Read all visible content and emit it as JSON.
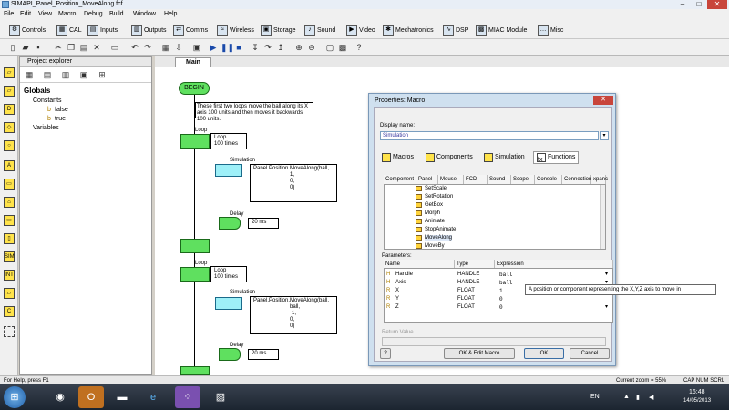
{
  "window": {
    "title": "SIMAPI_Panel_Position_MoveAlong.fcf",
    "minimize": "–",
    "maximize": "□",
    "close": "✕"
  },
  "menu": [
    "File",
    "Edit",
    "View",
    "Macro",
    "Debug",
    "Build",
    "Window",
    "Help"
  ],
  "component_toolbar": [
    "Controls",
    "CAL",
    "Inputs",
    "Outputs",
    "Comms",
    "Wireless",
    "Storage",
    "Sound",
    "Video",
    "Mechatronics",
    "DSP",
    "MIAC Module",
    "Misc"
  ],
  "explorer": {
    "header": "Project explorer",
    "tree": {
      "globals": "Globals",
      "constants": "Constants",
      "false": "false",
      "true": "true",
      "variables": "Variables"
    }
  },
  "tabs": {
    "main": "Main"
  },
  "flowchart": {
    "begin": "BEGIN",
    "comment": "These first two loops move the ball along its X axis 100 units and then moves it backwards 100 units.",
    "loop_label": "Loop",
    "loop_count": "100 times",
    "simulation_label": "Simulation",
    "delay_label": "Delay",
    "delay_value": "20 ms",
    "call1": "Panel.Position.MoveAlong(ball,\n                    1,\n                    0,\n                    0)",
    "call1_head": "Panel.Position.MoveAlong(ball,",
    "call1_args": [
      "1,",
      "0,",
      "0)"
    ],
    "call2_head": "Panel.Position.MoveAlong(ball,",
    "call2_args": [
      "ball,",
      "-1,",
      "0,",
      "0)"
    ],
    "call1_args_full": [
      "ball,",
      "1,",
      "0,",
      "0)"
    ]
  },
  "dialog": {
    "title": "Properties: Macro",
    "display_name_label": "Display name:",
    "display_name_value": "Simulation",
    "tabs": [
      "Macros",
      "Components",
      "Simulation",
      "Functions"
    ],
    "columns": [
      "Component",
      "Panel",
      "Mouse",
      "FCD",
      "Sound",
      "Scope",
      "Console",
      "Connection",
      "xpanc"
    ],
    "functions": [
      "SetScale",
      "SetRotation",
      "GetBox",
      "Morph",
      "Animate",
      "StopAnimate",
      "MoveAlong",
      "MoveBy"
    ],
    "params_label": "Parameters:",
    "param_columns": [
      "Name",
      "Type",
      "Expression"
    ],
    "params": [
      {
        "name": "Handle",
        "type": "HANDLE",
        "expr": "ball"
      },
      {
        "name": "Axis",
        "type": "HANDLE",
        "expr": "ball"
      },
      {
        "name": "X",
        "type": "FLOAT",
        "expr": "1"
      },
      {
        "name": "Y",
        "type": "FLOAT",
        "expr": "0"
      },
      {
        "name": "Z",
        "type": "FLOAT",
        "expr": "0"
      }
    ],
    "return_label": "Return Value",
    "help_btn": "?",
    "ok_edit_btn": "OK & Edit Macro",
    "ok_btn": "OK",
    "cancel_btn": "Cancel"
  },
  "tooltip": "A position or component representing the X,Y,Z axis to move in",
  "status": {
    "help": "For Help, press F1",
    "zoom": "Current zoom = 55%",
    "indicators": "CAP  NUM  SCRL"
  },
  "taskbar": {
    "lang": "EN",
    "time": "16:48",
    "date": "14/05/2013"
  }
}
